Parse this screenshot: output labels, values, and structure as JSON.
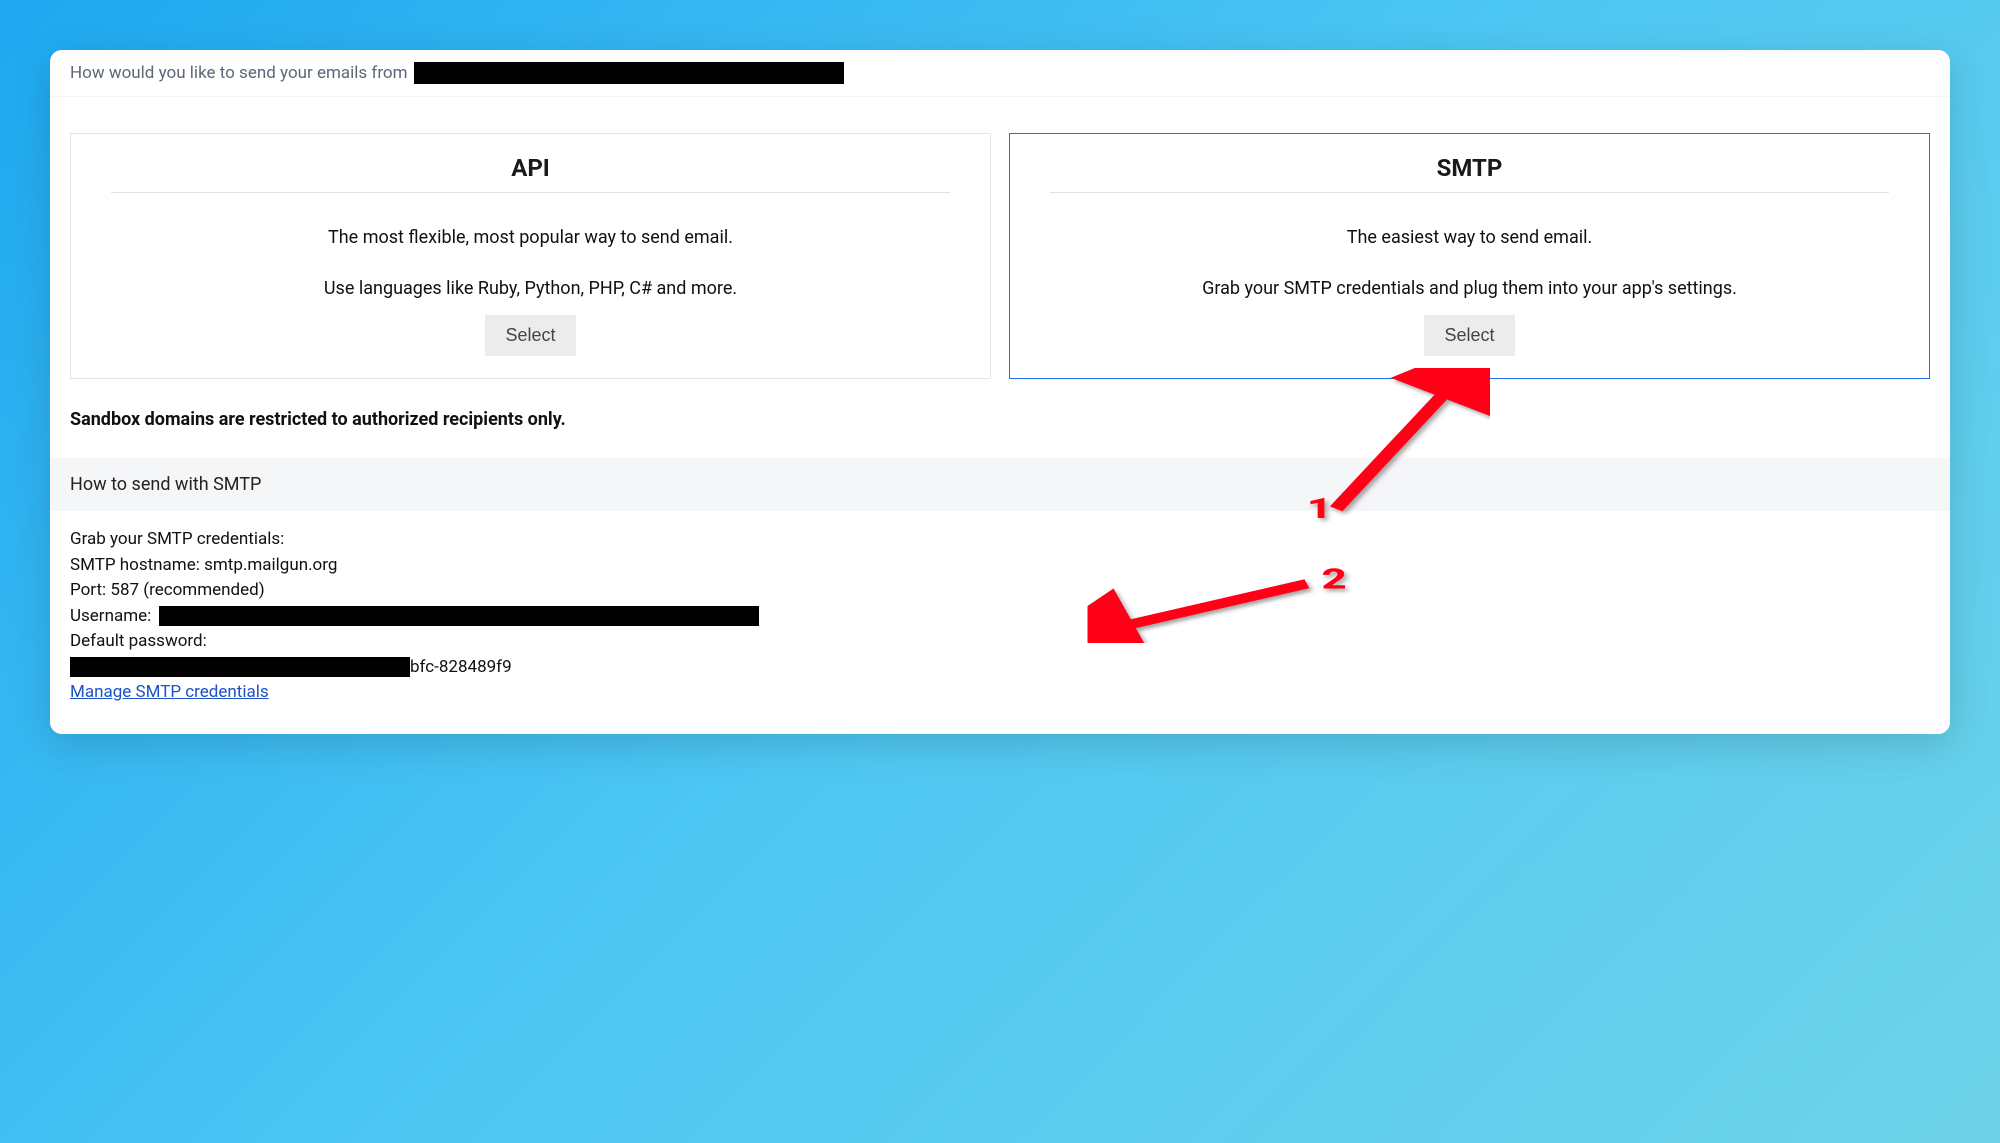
{
  "topbar": {
    "prompt_prefix": "How would you like to send your emails from"
  },
  "options": {
    "api": {
      "title": "API",
      "line1": "The most flexible, most popular way to send email.",
      "line2": "Use languages like Ruby, Python, PHP, C# and more.",
      "button": "Select"
    },
    "smtp": {
      "title": "SMTP",
      "line1": "The easiest way to send email.",
      "line2": "Grab your SMTP credentials and plug them into your app's settings.",
      "button": "Select"
    }
  },
  "sandbox_note": "Sandbox domains are restricted to authorized recipients only.",
  "howto_heading": "How to send with SMTP",
  "creds": {
    "intro": "Grab your SMTP credentials:",
    "hostname_label": "SMTP hostname:",
    "hostname_value": "smtp.mailgun.org",
    "port_label": "Port:",
    "port_value": "587 (recommended)",
    "username_label": "Username:",
    "password_label": "Default password:",
    "password_suffix": "bfc-828489f9",
    "manage_link": "Manage SMTP credentials"
  },
  "annotations": {
    "label1": "1",
    "label2": "2"
  }
}
